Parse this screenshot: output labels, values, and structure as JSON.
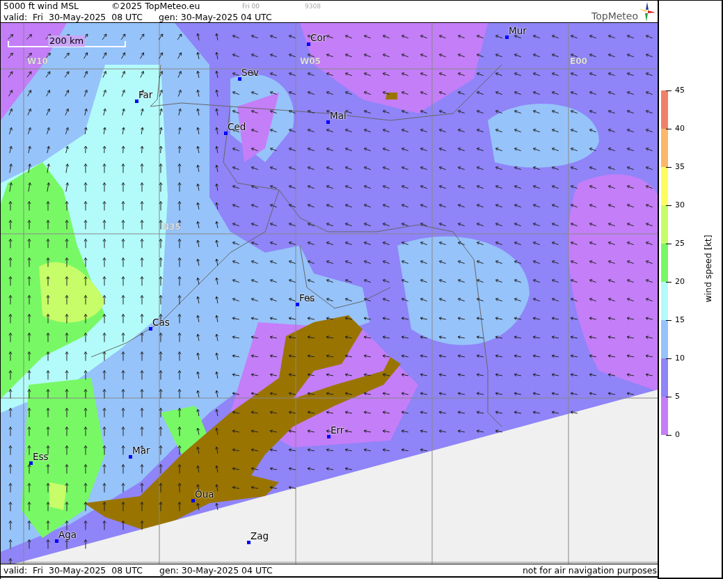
{
  "header": {
    "product": "5000 ft wind MSL",
    "copyright": "©2025 TopMeteo.eu",
    "run_tag": "Fri 00",
    "code": "9308",
    "valid": "valid:  Fri  30-May-2025  08 UTC",
    "generated": "gen: 30-May-2025 04 UTC",
    "logo": "TopMeteo"
  },
  "map": {
    "scale_label": "200 km",
    "grid_labels": [
      "W10",
      "W05",
      "E00",
      "N35"
    ],
    "cities": [
      "Cor",
      "Mur",
      "Sev",
      "Far",
      "Mal",
      "Ced",
      "Fes",
      "Cas",
      "Err",
      "Mar",
      "Ess",
      "Oua",
      "Aga",
      "Zag"
    ]
  },
  "legend": {
    "title": "wind speed [kt]",
    "ticks": [
      "45",
      "40",
      "35",
      "30",
      "25",
      "20",
      "15",
      "10",
      "5",
      "0"
    ],
    "bands": [
      {
        "color": "#f28068"
      },
      {
        "color": "#fdb76b"
      },
      {
        "color": "#fdfd61"
      },
      {
        "color": "#c6fd68"
      },
      {
        "color": "#78f865"
      },
      {
        "color": "#b3fbfb"
      },
      {
        "color": "#96c3fa"
      },
      {
        "color": "#8f84f8"
      },
      {
        "color": "#c47ef8"
      }
    ]
  },
  "footer": {
    "valid": "valid:  Fri  30-May-2025  08 UTC",
    "generated": "gen: 30-May-2025 04 UTC",
    "disclaimer": "not for air navigation purposes"
  }
}
